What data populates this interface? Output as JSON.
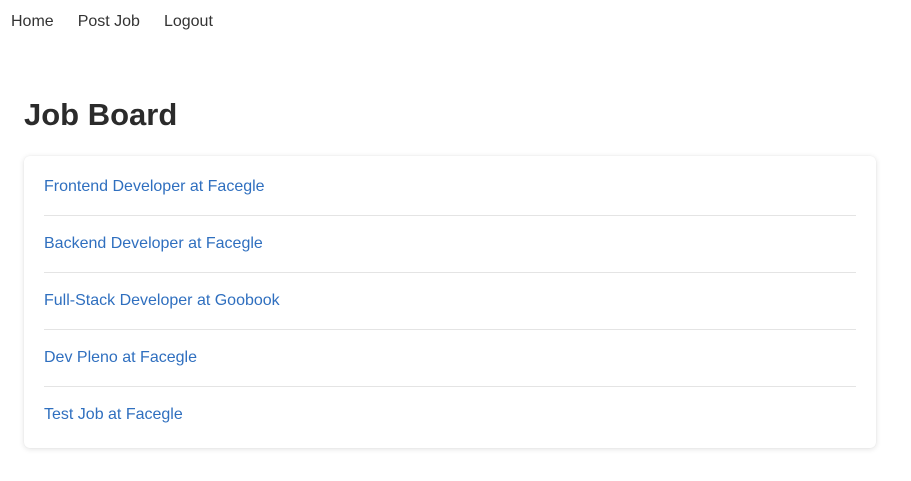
{
  "nav": {
    "items": [
      {
        "label": "Home"
      },
      {
        "label": "Post Job"
      },
      {
        "label": "Logout"
      }
    ]
  },
  "page": {
    "title": "Job Board"
  },
  "jobs": [
    {
      "label": "Frontend Developer at Facegle"
    },
    {
      "label": "Backend Developer at Facegle"
    },
    {
      "label": "Full-Stack Developer at Goobook"
    },
    {
      "label": "Dev Pleno at Facegle"
    },
    {
      "label": "Test Job at Facegle"
    }
  ],
  "colors": {
    "link": "#2f6fbf",
    "text": "#333333",
    "divider": "#e4e4e4"
  }
}
